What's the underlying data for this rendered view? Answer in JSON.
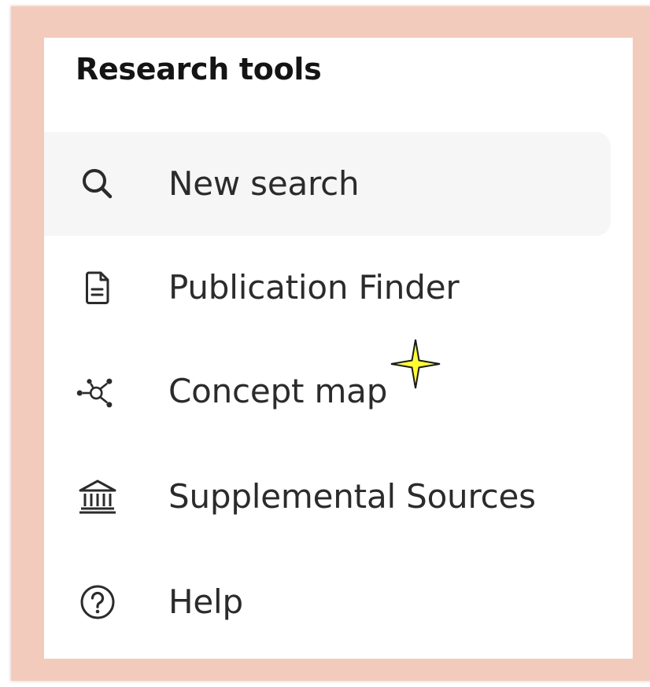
{
  "panel": {
    "title": "Research tools"
  },
  "menu": {
    "items": [
      {
        "label": "New search",
        "icon": "search-icon",
        "active": true
      },
      {
        "label": "Publication Finder",
        "icon": "document-icon",
        "active": false
      },
      {
        "label": "Concept map",
        "icon": "concept-map-icon",
        "active": false
      },
      {
        "label": "Supplemental Sources",
        "icon": "bank-icon",
        "active": false
      },
      {
        "label": "Help",
        "icon": "help-icon",
        "active": false
      }
    ]
  },
  "colors": {
    "frame": "#f3cbbd",
    "panel": "#ffffff",
    "active_item": "#f6f6f6",
    "text": "#2b2b2b",
    "title": "#141414",
    "cursor_star": "#ffff33"
  }
}
